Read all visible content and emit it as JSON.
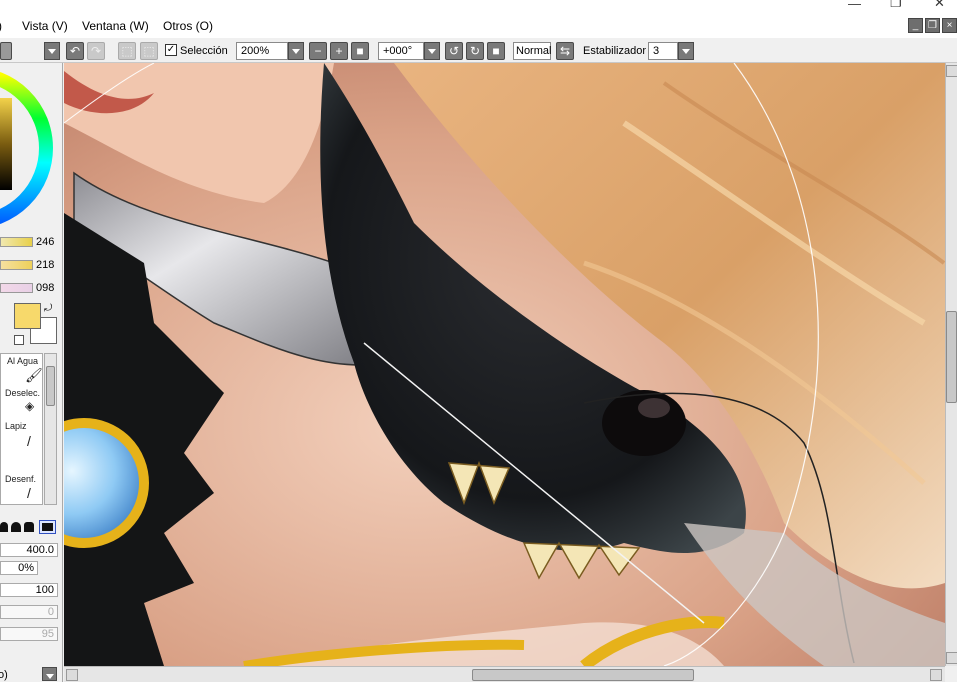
{
  "menu": {
    "items": [
      "Vista (V)",
      "Ventana (W)",
      "Otros (O)"
    ],
    "paren_fragment": ")"
  },
  "toolbar": {
    "selection_label": "Selección",
    "zoom_value": "200%",
    "rotation_value": "+000°",
    "blend_mode": "Normal",
    "stabilizer_label": "Estabilizador",
    "stabilizer_value": "3"
  },
  "color_panel": {
    "slider_values": [
      "246",
      "218",
      "098"
    ],
    "primary_color": "#f7d96b",
    "secondary_color": "#ffffff"
  },
  "tools": [
    {
      "label": "Al Agua"
    },
    {
      "label": "Deselec."
    },
    {
      "label": "Lapiz"
    },
    {
      "label": ""
    },
    {
      "label": "Desenf."
    }
  ],
  "brush_props": {
    "size": "400.0",
    "min_size": "0%",
    "density": "100",
    "blur": "0",
    "extra": "95",
    "bottom_fragment": "o)"
  }
}
